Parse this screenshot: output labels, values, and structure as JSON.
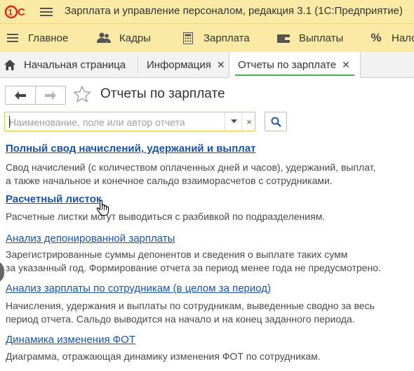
{
  "app": {
    "title": "Зарплата и управление персоналом, редакция 3.1  (1С:Предприятие)",
    "logo_text": "1С"
  },
  "sections": [
    {
      "label": "Главное",
      "icon": "menu-icon"
    },
    {
      "label": "Кадры",
      "icon": "people-icon"
    },
    {
      "label": "Зарплата",
      "icon": "calculator-icon"
    },
    {
      "label": "Выплаты",
      "icon": "wallet-icon"
    },
    {
      "label": "Нало",
      "icon": "percent-icon"
    }
  ],
  "tabs": [
    {
      "label": "Начальная страница",
      "icon": "home-icon",
      "closable": false,
      "active": false
    },
    {
      "label": "Информация",
      "closable": true,
      "active": false
    },
    {
      "label": "Отчеты по зарплате",
      "closable": true,
      "active": true
    }
  ],
  "page": {
    "title": "Отчеты по зарплате",
    "search_placeholder": "Наименование, поле или автор отчета",
    "search_value": "",
    "clear_glyph": "×"
  },
  "reports": [
    {
      "title": "Полный свод начислений, удержаний и выплат",
      "bold": true,
      "desc": [
        "Свод начислений (с количеством оплаченных дней и часов), удержаний, выплат,",
        "а также начальное и конечное сальдо взаиморасчетов с сотрудниками."
      ]
    },
    {
      "title": "Расчетный листок",
      "bold": true,
      "desc": [
        "Расчетные листки могут выводиться с разбивкой по подразделениям."
      ]
    },
    {
      "title": "Анализ депонированной зарплаты",
      "bold": false,
      "desc": [
        "Зарегистрированные суммы депонентов и сведения о выплате таких сумм",
        "за указанный год. Формирование отчета за период менее года не предусмотрено."
      ]
    },
    {
      "title": "Анализ зарплаты по сотрудникам (в целом за период)",
      "bold": false,
      "desc": [
        "Начисления, удержания и выплаты по сотрудникам, выведенные сводно за весь",
        "период отчета. Сальдо выводится на начало и на конец заданного периода."
      ]
    },
    {
      "title": "Динамика изменения ФОТ",
      "bold": false,
      "desc": [
        "Диаграмма, отражающая динамику изменения ФОТ по сотрудникам."
      ]
    }
  ],
  "colors": {
    "toolbar_bg": "#fbeaa6",
    "link": "#1a53a8",
    "logo_red": "#d9251c",
    "active_tab_underline": "#4caf50",
    "search_border": "#e8c24a"
  }
}
